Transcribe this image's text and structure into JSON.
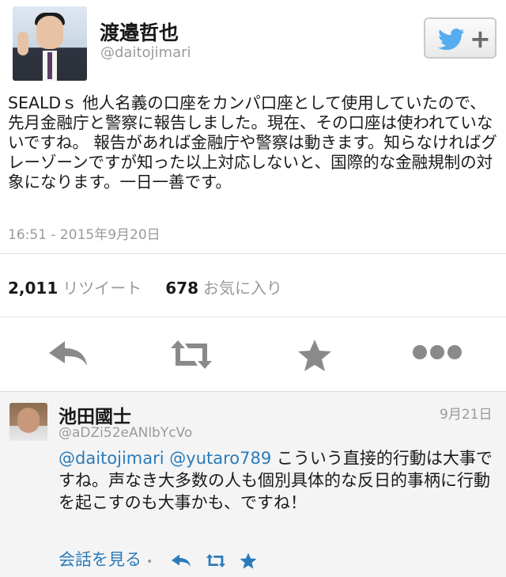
{
  "tweet": {
    "author_name": "渡邉哲也",
    "author_handle": "@daitojimari",
    "text": "SEALDｓ 他人名義の口座をカンパ口座として使用していたので、先月金融庁と警察に報告しました。現在、その口座は使われていないですね。 報告があれば金融庁や警察は動きます。知らなければグレーゾーンですが知った以上対応しないと、国際的な金融規制の対象になります。一日一善です。",
    "timestamp": "16:51 - 2015年9月20日",
    "retweet_count": "2,011",
    "retweet_label": "リツイート",
    "favorite_count": "678",
    "favorite_label": "お気に入り"
  },
  "reply": {
    "author_name": "池田國士",
    "author_handle": "@aDZi52eANlbYcVo",
    "date": "9月21日",
    "mention1": "@daitojimari",
    "mention2": "@yutaro789",
    "text": " こういう直接的行動は大事ですね。声なき大多数の人も個別具体的な反日的事柄に行動を起こすのも大事かも、ですね！",
    "view_conversation": "会話を見る",
    "separator": "•"
  },
  "icons": {
    "follow": "twitter-bird-follow-icon",
    "reply": "reply-arrow-icon",
    "retweet": "retweet-icon",
    "favorite": "star-icon",
    "more": "more-dots-icon"
  },
  "colors": {
    "link": "#2b7bb9",
    "twitter_blue": "#55acee",
    "icon_gray": "#8a8a8a"
  }
}
